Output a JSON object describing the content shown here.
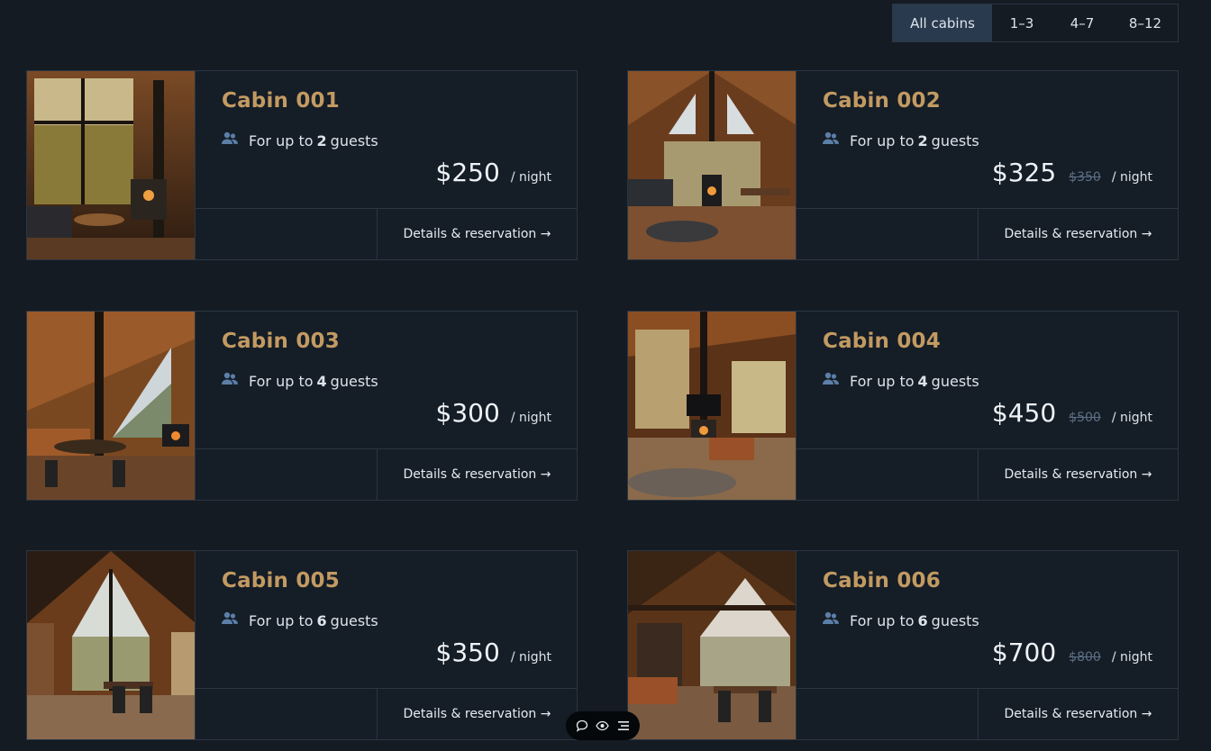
{
  "filter": {
    "options": [
      "All cabins",
      "1–3",
      "4–7",
      "8–12"
    ],
    "selected": "All cabins"
  },
  "cabins": [
    {
      "name": "Cabin 001",
      "guests_prefix": "For up to",
      "guests": "2",
      "guests_suffix": "guests",
      "price": "$250",
      "old_price": "",
      "per_night": "/ night",
      "cta": "Details & reservation →"
    },
    {
      "name": "Cabin 002",
      "guests_prefix": "For up to",
      "guests": "2",
      "guests_suffix": "guests",
      "price": "$325",
      "old_price": "$350",
      "per_night": "/ night",
      "cta": "Details & reservation →"
    },
    {
      "name": "Cabin 003",
      "guests_prefix": "For up to",
      "guests": "4",
      "guests_suffix": "guests",
      "price": "$300",
      "old_price": "",
      "per_night": "/ night",
      "cta": "Details & reservation →"
    },
    {
      "name": "Cabin 004",
      "guests_prefix": "For up to",
      "guests": "4",
      "guests_suffix": "guests",
      "price": "$450",
      "old_price": "$500",
      "per_night": "/ night",
      "cta": "Details & reservation →"
    },
    {
      "name": "Cabin 005",
      "guests_prefix": "For up to",
      "guests": "6",
      "guests_suffix": "guests",
      "price": "$350",
      "old_price": "",
      "per_night": "/ night",
      "cta": "Details & reservation →"
    },
    {
      "name": "Cabin 006",
      "guests_prefix": "For up to",
      "guests": "6",
      "guests_suffix": "guests",
      "price": "$700",
      "old_price": "$800",
      "per_night": "/ night",
      "cta": "Details & reservation →"
    }
  ],
  "floating_toolbar": {
    "icons": [
      "comment-icon",
      "eye-icon",
      "menu-icon"
    ]
  },
  "colors": {
    "background": "#141b23",
    "accent": "#c29a62",
    "filter_active": "#2a3a4e",
    "border": "#2b3642",
    "guest_icon": "#5b7fa8",
    "old_price": "#5c7086"
  }
}
